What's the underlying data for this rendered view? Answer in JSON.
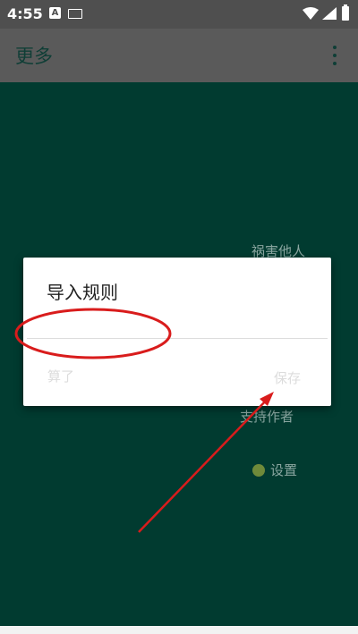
{
  "status_bar": {
    "time": "4:55",
    "notification_icon_letter": "A",
    "icons": [
      "a-notification-icon",
      "keyboard-icon",
      "wifi-icon",
      "signal-icon",
      "battery-icon"
    ]
  },
  "app_bar": {
    "title": "更多",
    "menu_icon": "overflow-menu-icon"
  },
  "background_menu": {
    "items": [
      {
        "label": "祸害他人"
      },
      {
        "label": "支持作者"
      },
      {
        "label": "设置",
        "icon": "settings-icon"
      }
    ]
  },
  "dialog": {
    "title": "导入规则",
    "input_value": "",
    "cancel_label": "算了",
    "save_label": "保存"
  },
  "annotation": {
    "color": "#d91c1c",
    "shapes": [
      "ellipse-around-input",
      "arrow-to-save-button"
    ]
  },
  "colors": {
    "background": "#013b30",
    "app_bar": "#5a5a5a",
    "status_bar": "#4f4f4f",
    "dialog": "#ffffff"
  }
}
